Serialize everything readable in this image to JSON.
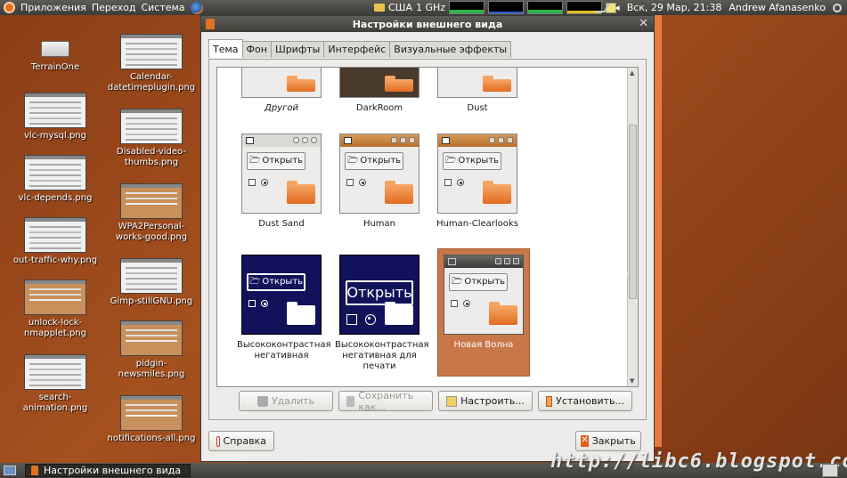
{
  "top_panel": {
    "menu": [
      "Приложения",
      "Переход",
      "Система"
    ],
    "keyboard_layout": "США",
    "cpu_freq": "1 GHz",
    "clock": "Вск, 29 Мар, 21:38",
    "user": "Andrew Afanasenko"
  },
  "desktop": {
    "icons": [
      {
        "label": "TerrainOne"
      },
      {
        "label": "Calendar-datetimeplugin.png"
      },
      {
        "label": "vlc-mysql.png"
      },
      {
        "label": "Disabled-video-thumbs.png"
      },
      {
        "label": "vlc-depends.png"
      },
      {
        "label": "WPA2Personal-works-good.png"
      },
      {
        "label": "out-traffic-why.png"
      },
      {
        "label": "Gimp-stillGNU.png"
      },
      {
        "label": "unlock-lock-nmapplet.png"
      },
      {
        "label": "pidgin-newsmiles.png"
      },
      {
        "label": "search-animation.png"
      },
      {
        "label": "notifications-all.png"
      }
    ]
  },
  "dialog": {
    "title": "Настройки внешнего вида",
    "tabs": [
      {
        "label": "Тема",
        "active": true
      },
      {
        "label": "Фон",
        "active": false
      },
      {
        "label": "Шрифты",
        "active": false
      },
      {
        "label": "Интерфейс",
        "active": false
      },
      {
        "label": "Визуальные эффекты",
        "active": false
      }
    ],
    "preview_button": "Открыть",
    "themes": [
      {
        "name": "Другой"
      },
      {
        "name": "DarkRoom"
      },
      {
        "name": "Dust"
      },
      {
        "name": "Dust Sand"
      },
      {
        "name": "Human"
      },
      {
        "name": "Human-Clearlooks"
      },
      {
        "name": "Высококонтрастная негативная"
      },
      {
        "name": "Высококонтрастная негативная для печати"
      },
      {
        "name": "Новая Волна",
        "selected": true
      }
    ],
    "actions": {
      "delete": "Удалить",
      "save_as": "Сохранить как...",
      "customize": "Настроить...",
      "install": "Установить..."
    },
    "help": "Справка",
    "close": "Закрыть"
  },
  "taskbar": {
    "window": "Настройки внешнего вида"
  },
  "watermark": "http://libc6.blogspot.com",
  "colors": {
    "accent": "#e3711a",
    "selection": "#c8774a",
    "panel": "#3d3c38"
  }
}
